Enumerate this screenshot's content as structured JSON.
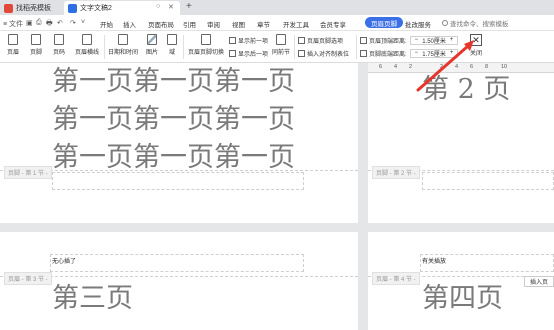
{
  "tabs": {
    "inactive": "找稻壳模板",
    "active": "文字文稿2",
    "new_tab": "+"
  },
  "menu": {
    "file": "≡ 文件",
    "items": [
      "开始",
      "插入",
      "页面布局",
      "引用",
      "审阅",
      "视图",
      "章节",
      "开发工具",
      "会员专享"
    ],
    "active_pill": "页眉页脚",
    "extra": "批改服务",
    "search_placeholder": "查找命令、搜索模板"
  },
  "ribbon": {
    "header": "页眉",
    "footer": "页脚",
    "page_num": "页码",
    "header_line": "页眉横线",
    "datetime": "日期和时间",
    "picture": "图片",
    "field": "域",
    "switch": "页眉页脚切换",
    "show_prev": "显示前一项",
    "show_next": "显示后一项",
    "same_prev": "同前节",
    "hf_options": "页眉页脚选项",
    "insert_align": "插入对齐制表位",
    "top_label": "页眉顶端距离:",
    "top_value": "1.50厘米",
    "bottom_label": "页脚底端距离:",
    "bottom_value": "1.75厘米",
    "close": "关闭",
    "minus": "−",
    "plus": "+"
  },
  "ruler": [
    "6",
    "4",
    "2",
    "2",
    "4",
    "6",
    "8",
    "10"
  ],
  "pages": {
    "p1_lines": [
      "第一页第一页第一页",
      "第一页第一页第一页",
      "第一页第一页第一页"
    ],
    "p1_footer": "页脚 - 第 1 节 -",
    "p2_text": "第 2 页",
    "p2_footer": "页脚 - 第 2 节 -",
    "p3_header_text": "无心插了",
    "p3_footer": "页眉 - 第 3 节 -",
    "p3_text": "第三页",
    "p4_header_text": "有关插放",
    "p4_footer": "页眉 - 第 4 节 -",
    "p4_text": "第四页",
    "insert_btn": "插入页"
  }
}
